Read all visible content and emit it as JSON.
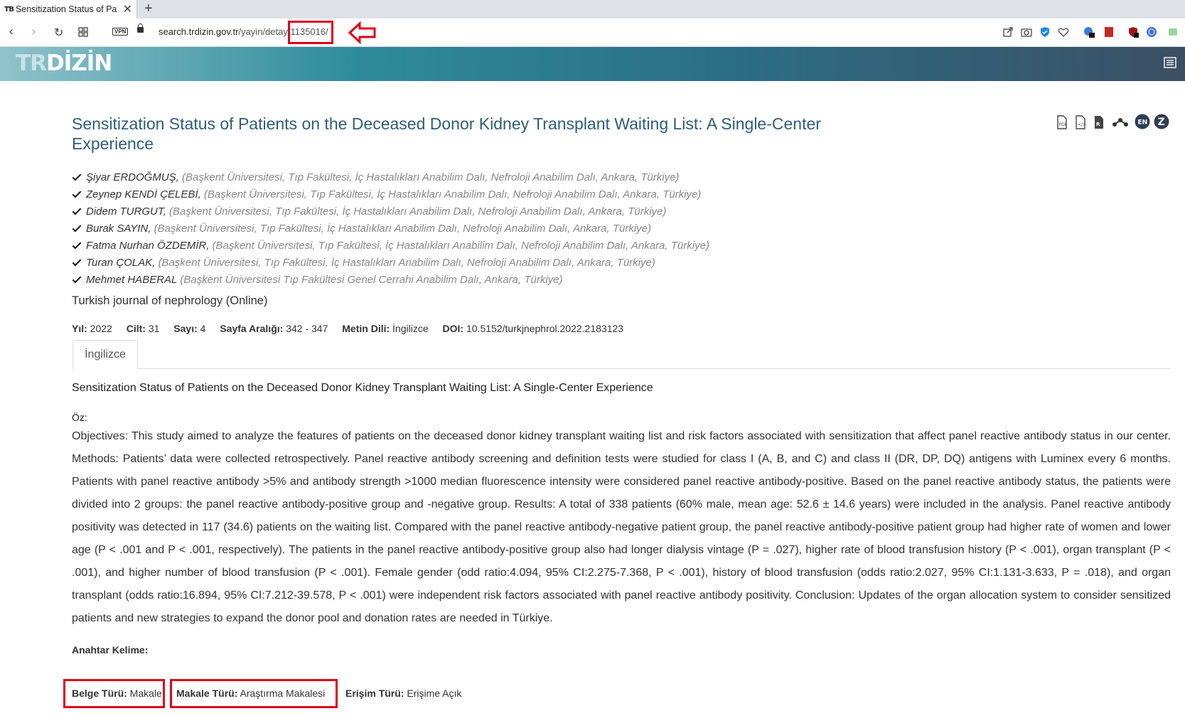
{
  "browser": {
    "tab_title": "Sensitization Status of Patie",
    "tab_favicon": "TƁ",
    "url_domain": "search.trdizin.gov.tr",
    "url_path": "/yayin/detay/",
    "url_id": "1135016/",
    "vpn_label": "VPN"
  },
  "site": {
    "logo_text": "TR",
    "logo_main": "DİZİN"
  },
  "article": {
    "title": "Sensitization Status of Patients on the Deceased Donor Kidney Transplant Waiting List: A Single-Center Experience",
    "authors": [
      {
        "name": "Şiyar ERDOĞMUŞ,",
        "affiliation": "(Başkent Üniversitesi, Tıp Fakültesi, İç Hastalıkları Anabilim Dalı, Nefroloji Anabilim Dalı, Ankara, Türkiye)"
      },
      {
        "name": "Zeynep KENDİ ÇELEBİ,",
        "affiliation": "(Başkent Üniversitesi, Tıp Fakültesi, İç Hastalıkları Anabilim Dalı, Nefroloji Anabilim Dalı, Ankara, Türkiye)"
      },
      {
        "name": "Didem TURGUT,",
        "affiliation": "(Başkent Üniversitesi, Tıp Fakültesi, İç Hastalıkları Anabilim Dalı, Nefroloji Anabilim Dalı, Ankara, Türkiye)"
      },
      {
        "name": "Burak SAYIN,",
        "affiliation": "(Başkent Üniversitesi, Tıp Fakültesi, İç Hastalıkları Anabilim Dalı, Nefroloji Anabilim Dalı, Ankara, Türkiye)"
      },
      {
        "name": "Fatma Nurhan ÖZDEMİR,",
        "affiliation": "(Başkent Üniversitesi, Tıp Fakültesi, İç Hastalıkları Anabilim Dalı, Nefroloji Anabilim Dalı, Ankara, Türkiye)"
      },
      {
        "name": "Turan ÇOLAK,",
        "affiliation": "(Başkent Üniversitesi, Tıp Fakültesi, İç Hastalıkları Anabilim Dalı, Nefroloji Anabilim Dalı, Ankara, Türkiye)"
      },
      {
        "name": "Mehmet HABERAL",
        "affiliation": "(Başkent Üniversitesi Tıp Fakültesi Genel Cerrahi Anabilim Dalı, Ankara, Türkiye)"
      }
    ],
    "journal": "Turkish journal of nephrology (Online)",
    "meta": {
      "year_label": "Yıl:",
      "year": "2022",
      "volume_label": "Cilt:",
      "volume": "31",
      "issue_label": "Sayı:",
      "issue": "4",
      "pages_label": "Sayfa Aralığı:",
      "pages": "342 - 347",
      "lang_label": "Metin Dili:",
      "lang": "İngilizce",
      "doi_label": "DOI:",
      "doi": "10.5152/turkjnephrol.2022.2183123"
    },
    "tab_label": "İngilizce",
    "abstract_title": "Sensitization Status of Patients on the Deceased Donor Kidney Transplant Waiting List: A Single-Center Experience",
    "abstract_label": "Öz:",
    "abstract": "Objectives: This study aimed to analyze the features of patients on the deceased donor kidney transplant waiting list and risk factors associated with sensitization that affect panel reactive antibody status in our center. Methods: Patients’ data were collected retrospectively. Panel reactive antibody screening and definition tests were studied for class I (A, B, and C) and class II (DR, DP, DQ) antigens with Luminex every 6 months. Patients with panel reactive antibody >5% and antibody strength >1000 median fluorescence intensity were considered panel reactive antibody-positive. Based on the panel reactive antibody status, the patients were divided into 2 groups: the panel reactive antibody-positive group and -negative group. Results: A total of 338 patients (60% male, mean age: 52.6 ± 14.6 years) were included in the analysis. Panel reactive antibody positivity was detected in 117 (34.6) patients on the waiting list. Compared with the panel reactive antibody-negative patient group, the panel reactive antibody-positive patient group had higher rate of women and lower age (P < .001 and P < .001, respectively). The patients in the panel reactive antibody-positive group also had longer dialysis vintage (P = .027), higher rate of blood transfusion history (P < .001), organ transplant (P < .001), and higher number of blood transfusion (P < .001). Female gender (odd ratio:4.094, 95% CI:2.275-7.368, P < .001), history of blood transfusion (odds ratio:2.027, 95% CI:1.131-3.633, P = .018), and organ transplant (odds ratio:16.894, 95% CI:7.212-39.578, P < .001) were independent risk factors associated with panel reactive antibody positivity. Conclusion: Updates of the organ allocation system to consider sensitized patients and new strategies to expand the donor pool and donation rates are needed in Türkiye.",
    "keywords_label": "Anahtar Kelime:",
    "doc_type_label": "Belge Türü:",
    "doc_type": "Makale",
    "article_type_label": "Makale Türü:",
    "article_type": "Araştırma Makalesi",
    "access_type_label": "Erişim Türü:",
    "access_type": "Erişime Açık"
  },
  "icons": {
    "action_icons": [
      "pdf-icon",
      "xml-icon",
      "ris-icon",
      "mendeley-icon",
      "en-badge-icon",
      "zotero-icon"
    ],
    "en_badge_text": "EN",
    "zotero_text": "Z"
  },
  "colors": {
    "title": "#2e5e79",
    "highlight": "#e0001b",
    "header_start": "#8ec3cc",
    "header_end": "#3b4f64"
  }
}
